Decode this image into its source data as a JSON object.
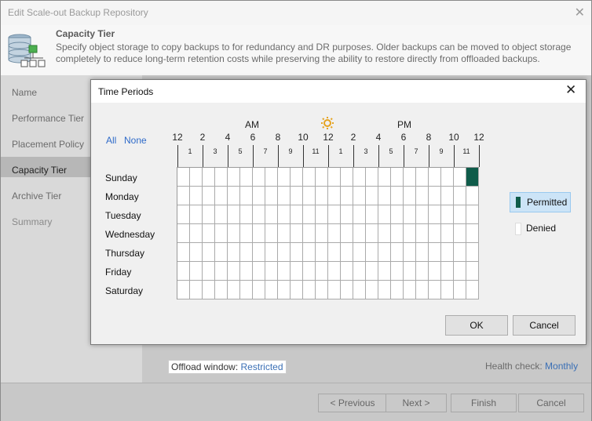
{
  "window": {
    "title": "Edit Scale-out Backup Repository"
  },
  "header": {
    "title": "Capacity Tier",
    "description": "Specify object storage to copy backups to for redundancy and DR purposes. Older backups can be moved to object storage completely to reduce long-term retention costs while preserving the ability to restore directly from offloaded backups."
  },
  "sidebar": {
    "items": [
      {
        "label": "Name"
      },
      {
        "label": "Performance Tier"
      },
      {
        "label": "Placement Policy"
      },
      {
        "label": "Capacity Tier"
      },
      {
        "label": "Archive Tier"
      },
      {
        "label": "Summary"
      }
    ],
    "selected": "Capacity Tier"
  },
  "content": {
    "offload_label": "Offload window:",
    "offload_value": "Restricted",
    "health_label": "Health check:",
    "health_value": "Monthly"
  },
  "footer": {
    "previous": "< Previous",
    "next": "Next >",
    "finish": "Finish",
    "cancel": "Cancel"
  },
  "dialog": {
    "title": "Time Periods",
    "all": "All",
    "none": "None",
    "am": "AM",
    "pm": "PM",
    "hours_major": [
      "12",
      "2",
      "4",
      "6",
      "8",
      "10",
      "12",
      "2",
      "4",
      "6",
      "8",
      "10",
      "12"
    ],
    "hours_minor": [
      "1",
      "3",
      "5",
      "7",
      "9",
      "11",
      "1",
      "3",
      "5",
      "7",
      "9",
      "11"
    ],
    "days": [
      "Sunday",
      "Monday",
      "Tuesday",
      "Wednesday",
      "Thursday",
      "Friday",
      "Saturday"
    ],
    "permitted_cells": [
      {
        "day": "Sunday",
        "hour": 23
      }
    ],
    "permitted_color": "#0f5c4a",
    "legend_permitted": "Permitted",
    "legend_denied": "Denied",
    "ok": "OK",
    "cancel": "Cancel"
  }
}
